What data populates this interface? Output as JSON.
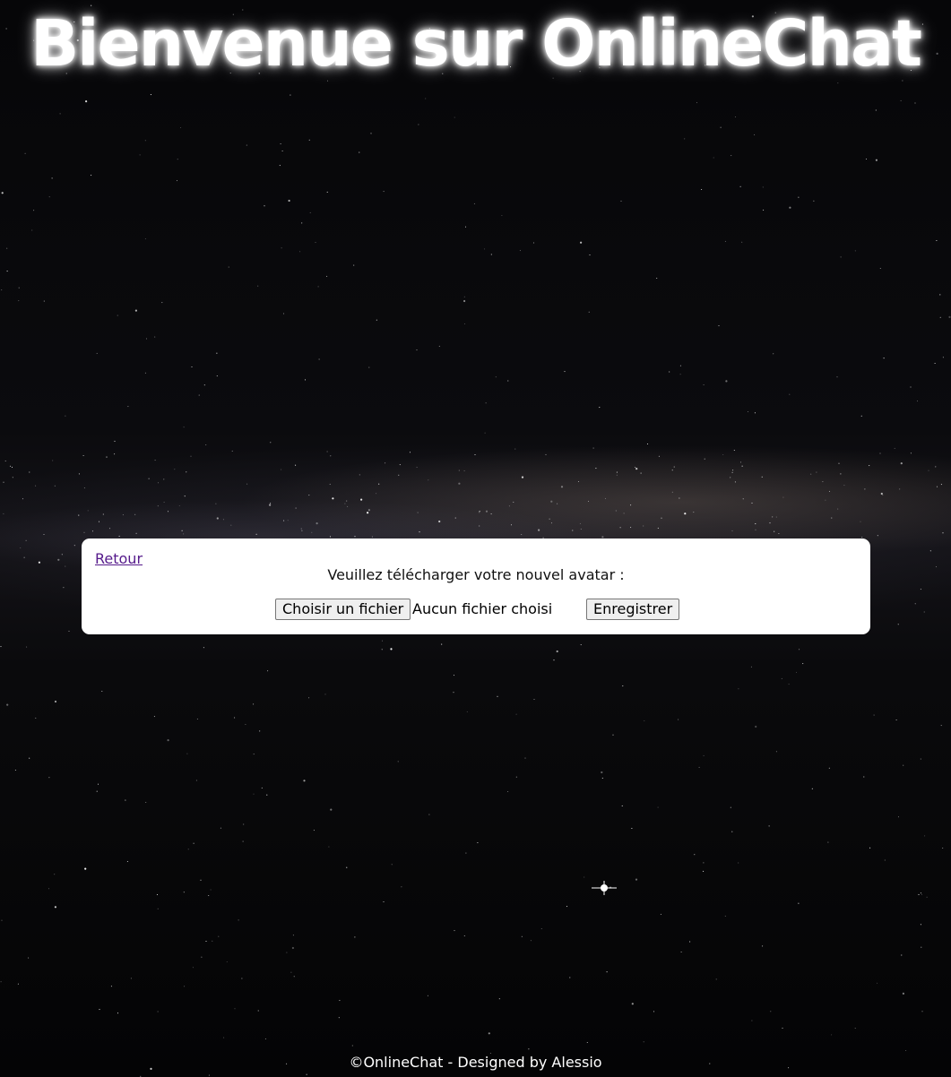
{
  "header": {
    "title": "Bienvenue sur OnlineChat"
  },
  "avatar_form": {
    "back_link": "Retour",
    "prompt": "Veuillez télécharger votre nouvel avatar :",
    "file_button_label": "Choisir un fichier",
    "file_status": "Aucun fichier choisi",
    "save_button_label": "Enregistrer"
  },
  "footer": {
    "text": "©OnlineChat - Designed by Alessio"
  },
  "colors": {
    "title_text": "#ffffff",
    "panel_background": "#ffffff",
    "link_visited": "#551a8b",
    "page_background": "#050507"
  }
}
